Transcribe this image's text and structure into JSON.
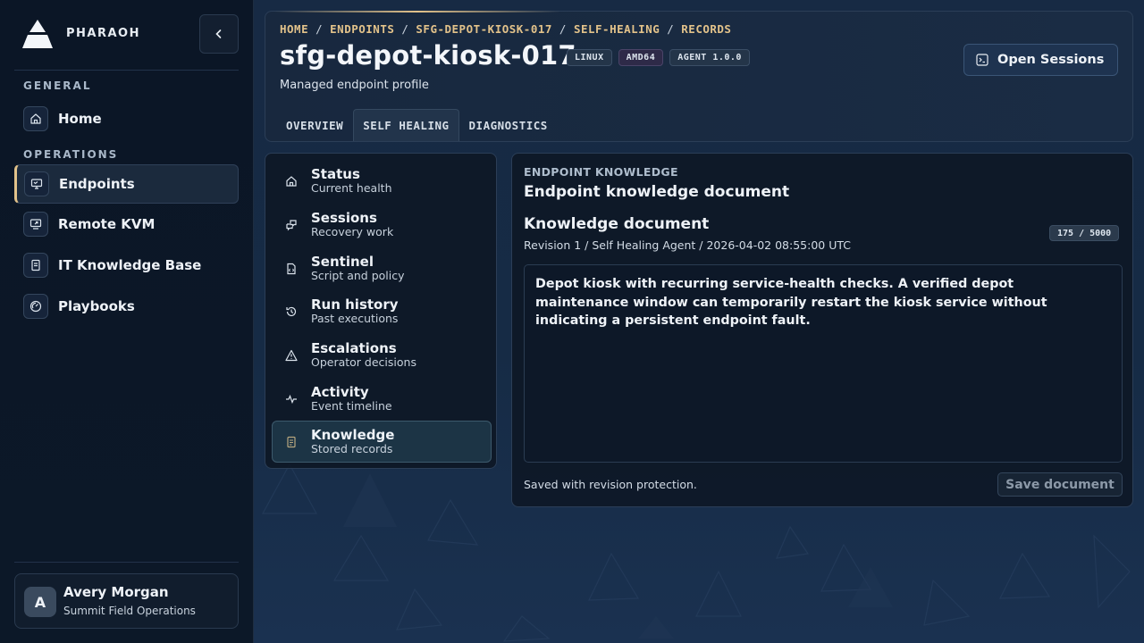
{
  "brand": {
    "name": "PHARAOH"
  },
  "sidebar": {
    "sections": [
      {
        "label": "GENERAL"
      },
      {
        "label": "OPERATIONS"
      }
    ],
    "items": [
      {
        "label": "Home",
        "icon": "home-icon"
      },
      {
        "label": "Endpoints",
        "icon": "monitor-icon",
        "active": true
      },
      {
        "label": "Remote KVM",
        "icon": "remote-screen-icon"
      },
      {
        "label": "IT Knowledge Base",
        "icon": "book-icon"
      },
      {
        "label": "Playbooks",
        "icon": "gauge-icon"
      }
    ]
  },
  "user": {
    "initial": "A",
    "name": "Avery Morgan",
    "org": "Summit Field Operations"
  },
  "header": {
    "breadcrumb": [
      "HOME",
      "ENDPOINTS",
      "SFG-DEPOT-KIOSK-017",
      "SELF-HEALING",
      "RECORDS"
    ],
    "breadcrumb_sep": "/",
    "title": "sfg-depot-kiosk-017",
    "badges": [
      "LINUX",
      "AMD64",
      "AGENT 1.0.0"
    ],
    "subtitle": "Managed endpoint profile",
    "open_sessions_label": "Open Sessions",
    "tabs": [
      {
        "label": "OVERVIEW"
      },
      {
        "label": "SELF HEALING",
        "active": true
      },
      {
        "label": "DIAGNOSTICS"
      }
    ]
  },
  "menu": [
    {
      "title": "Status",
      "sub": "Current health",
      "icon": "home-icon"
    },
    {
      "title": "Sessions",
      "sub": "Recovery work",
      "icon": "chat-icon"
    },
    {
      "title": "Sentinel",
      "sub": "Script and policy",
      "icon": "script-file-icon"
    },
    {
      "title": "Run history",
      "sub": "Past executions",
      "icon": "history-icon"
    },
    {
      "title": "Escalations",
      "sub": "Operator decisions",
      "icon": "warning-icon"
    },
    {
      "title": "Activity",
      "sub": "Event timeline",
      "icon": "pulse-icon"
    },
    {
      "title": "Knowledge",
      "sub": "Stored records",
      "icon": "document-icon",
      "active": true
    }
  ],
  "content": {
    "eyebrow": "ENDPOINT KNOWLEDGE",
    "title": "Endpoint knowledge document",
    "doc_heading": "Knowledge document",
    "revision": "Revision 1 / Self Healing Agent / 2026-04-02 08:55:00 UTC",
    "counter": "175 / 5000",
    "body": "Depot kiosk with recurring service-health checks. A verified depot maintenance window can temporarily restart the kiosk service without indicating a persistent endpoint fault.",
    "save_status": "Saved with revision protection.",
    "save_label": "Save document"
  },
  "colors": {
    "accent": "#e2c28a",
    "background": "#12233a",
    "sidebar": "#0b1626"
  }
}
